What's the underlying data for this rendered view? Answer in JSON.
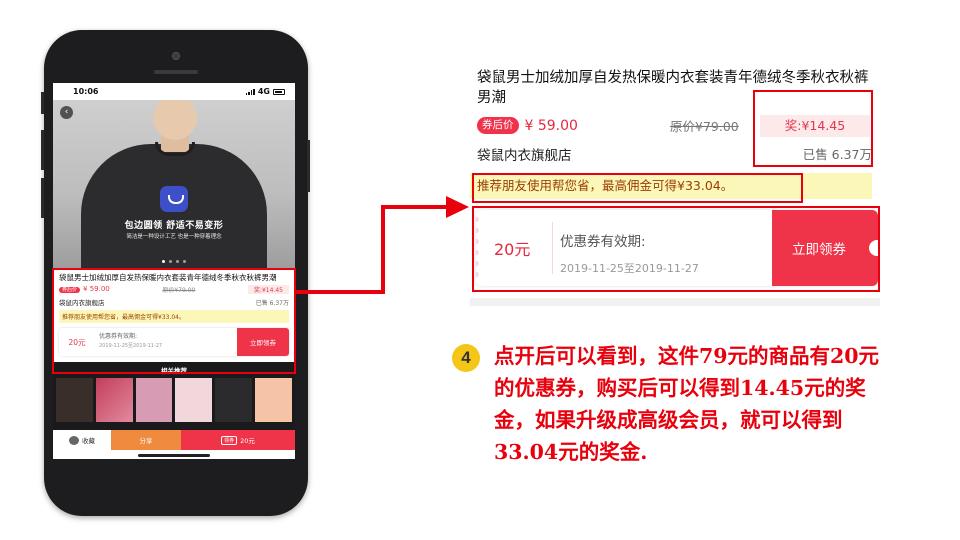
{
  "colors": {
    "accent_red": "#ef3348",
    "annotation_red": "#e8000c",
    "badge_yellow": "#f5c518",
    "recommend_bg": "#fbf7b8"
  },
  "phone": {
    "status": {
      "time": "10:06",
      "network": "4G"
    },
    "hero": {
      "slogan": "包边圆领  舒适不易变形",
      "subslogan": "简洁是一种设计工艺 也是一种穿着理念"
    },
    "bottom_bar": {
      "favorite_label": "收藏",
      "share_label": "分享",
      "buy_pill": "领券",
      "buy_price": "20元"
    },
    "related_title": "相关推荐"
  },
  "product": {
    "title": "袋鼠男士加绒加厚自发热保暖内衣套装青年德绒冬季秋衣秋裤男潮",
    "price_tag": "券后价",
    "price": "¥ 59.00",
    "original_price": "原价¥79.00",
    "bonus": "奖:¥14.45",
    "store": "袋鼠内衣旗舰店",
    "sold": "已售 6.37万",
    "recommend": "推荐朋友使用帮您省，最高佣金可得¥33.04。",
    "coupon": {
      "amount": "20元",
      "validity_label": "优惠券有效期:",
      "dates": "2019-11-25至2019-11-27",
      "button": "立即领券"
    }
  },
  "explanation": {
    "step": "4",
    "text": "点开后可以看到，这件79元的商品有20元的优惠券，购买后可以得到14.45元的奖金，如果升级成高级会员，就可以得到33.04元的奖金."
  }
}
